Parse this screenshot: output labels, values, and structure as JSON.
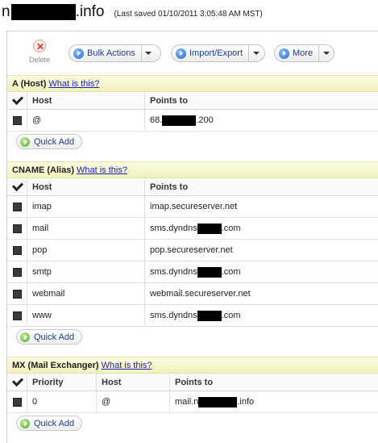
{
  "header": {
    "domain_prefix": "n",
    "domain_suffix": ".info",
    "last_saved": "(Last saved 01/10/2011 3:05:48 AM MST)"
  },
  "toolbar": {
    "delete_label": "Delete",
    "bulk_actions_label": "Bulk Actions",
    "import_export_label": "Import/Export",
    "more_label": "More"
  },
  "a_section": {
    "title": "A (Host)",
    "help_link": "What is this?",
    "columns": [
      "Host",
      "Points to"
    ],
    "rows": [
      {
        "host": "@",
        "points_prefix": "68.",
        "points_suffix": ".200"
      }
    ],
    "quick_add": "Quick Add"
  },
  "cname_section": {
    "title": "CNAME (Alias)",
    "help_link": "What is this?",
    "columns": [
      "Host",
      "Points to"
    ],
    "rows": [
      {
        "host": "imap",
        "points_prefix": "imap.secureserver.net",
        "points_suffix": ""
      },
      {
        "host": "mail",
        "points_prefix": "sms.dyndns",
        "points_suffix": ".com"
      },
      {
        "host": "pop",
        "points_prefix": "pop.secureserver.net",
        "points_suffix": ""
      },
      {
        "host": "smtp",
        "points_prefix": "sms.dyndns",
        "points_suffix": ".com"
      },
      {
        "host": "webmail",
        "points_prefix": "webmail.secureserver.net",
        "points_suffix": ""
      },
      {
        "host": "www",
        "points_prefix": "sms.dyndns",
        "points_suffix": ".com"
      }
    ],
    "quick_add": "Quick Add"
  },
  "mx_section": {
    "title": "MX (Mail Exchanger)",
    "help_link": "What is this?",
    "columns": [
      "Priority",
      "Host",
      "Points to"
    ],
    "rows": [
      {
        "priority": "0",
        "host": "@",
        "points_prefix": "mail.n",
        "points_suffix": ".info"
      }
    ],
    "quick_add": "Quick Add"
  },
  "colors": {
    "section_header_bg": "#f1f1bf",
    "link": "#1a24b8",
    "button_text": "#1a3f8a",
    "redaction": "#000000"
  }
}
